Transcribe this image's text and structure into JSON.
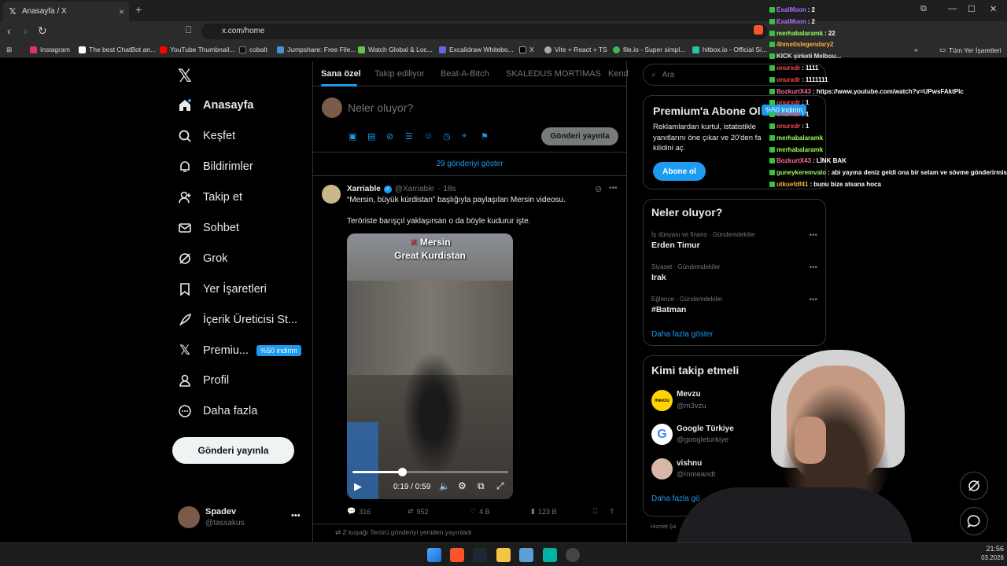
{
  "browser": {
    "tab_title": "Anasayfa / X",
    "url": "x.com/home",
    "bookmarks": [
      "Instagram",
      "The best ChatBot an...",
      "YouTube Thumbnail...",
      "cobalt",
      "Jumpshare: Free File...",
      "Watch Global & Loc...",
      "Excalidraw Whitebo...",
      "X",
      "Vite + React + TS",
      "file.io - Super simpl...",
      "hitbox.io - Official Si..."
    ],
    "bookmarks_all": "Tüm Yer İşaretleri"
  },
  "nav": {
    "items": [
      {
        "label": "Anasayfa",
        "icon": "home-icon"
      },
      {
        "label": "Keşfet",
        "icon": "search-icon"
      },
      {
        "label": "Bildirimler",
        "icon": "bell-icon"
      },
      {
        "label": "Takip et",
        "icon": "follow-icon"
      },
      {
        "label": "Sohbet",
        "icon": "mail-icon"
      },
      {
        "label": "Grok",
        "icon": "grok-icon"
      },
      {
        "label": "Yer İşaretleri",
        "icon": "bookmark-icon"
      },
      {
        "label": "İçerik Üreticisi St...",
        "icon": "rocket-icon"
      },
      {
        "label": "Premiu...",
        "icon": "x-icon"
      },
      {
        "label": "Profil",
        "icon": "profile-icon"
      },
      {
        "label": "Daha fazla",
        "icon": "more-icon"
      }
    ],
    "premium_badge": "%50 indirim",
    "post_button": "Gönderi yayınla",
    "user": {
      "name": "Spadev",
      "handle": "@tassakus"
    }
  },
  "feed": {
    "tabs": [
      "Sana özel",
      "Takip ediliyor",
      "Beat-A-Bitch",
      "SKALEDUS MORTIMAS",
      "Kend"
    ],
    "compose_placeholder": "Neler oluyor?",
    "compose_button": "Gönderi yayınla",
    "show_posts": "29 gönderiyi göster",
    "post": {
      "author": "Xarriable",
      "handle": "@Xarriable",
      "time": "18s",
      "text1": "“Mersin, büyük kürdistan” başlığıyla paylaşılan Mersin videosu.",
      "text2": "Teröriste barışçıl yaklaşırsan o da böyle kudurur işte.",
      "video_title1": "Mersin",
      "video_title2": "Great Kurdistan",
      "video_time": "0:19 / 0:59",
      "video_progress": 0.32,
      "replies": "316",
      "reposts": "952",
      "likes": "4 B",
      "views": "123 B"
    },
    "repost_note": "Z kuşağı Terörü gönderiyi yeniden yayınladı"
  },
  "right": {
    "search_placeholder": "Ara",
    "premium": {
      "title": "Premium'a Abone Ol",
      "badge": "%50 indirim",
      "text": "Reklamlardan kurtul, istatistikle yanıtlarını öne çıkar ve 20'den fa kilidini aç.",
      "button": "Abone ol"
    },
    "trends_title": "Neler oluyor?",
    "trends": [
      {
        "meta": "İş dünyası ve finans · Gündemdekiler",
        "name": "Erden Timur"
      },
      {
        "meta": "Siyaset · Gündemdekiler",
        "name": "Irak"
      },
      {
        "meta": "Eğlence · Gündemdekiler",
        "name": "#Batman"
      }
    ],
    "show_more": "Daha fazla göster",
    "who_title": "Kimi takip etmeli",
    "who": [
      {
        "name": "Mevzu",
        "handle": "@m3vzu"
      },
      {
        "name": "Google Türkiye",
        "handle": "@googleturkiye"
      },
      {
        "name": "vishnu",
        "handle": "@mmeandt"
      }
    ],
    "who_more": "Daha fazla gö",
    "footer": "Hizmet Şa"
  },
  "chat": [
    {
      "user": "ExalMoon",
      "msg": "2",
      "color": "#b36bff"
    },
    {
      "user": "ExalMoon",
      "msg": "2",
      "color": "#b36bff"
    },
    {
      "user": "merhabalaramk",
      "msg": "22",
      "color": "#9cff5a"
    },
    {
      "user": "4hmetislegendary2",
      "msg": "",
      "color": "#ffb13b"
    },
    {
      "user": "KICK şirketi Melbou...",
      "msg": "",
      "color": "#dddddd"
    },
    {
      "user": "onurxdr",
      "msg": "1111",
      "color": "#ff4d4d"
    },
    {
      "user": "onurxdr",
      "msg": "1111111",
      "color": "#ff4d4d"
    },
    {
      "user": "BozkurtX43",
      "msg": "https://www.youtube.com/watch?v=UPwsFAktPIc",
      "color": "#ff6b9a"
    },
    {
      "user": "onurxdr",
      "msg": "1",
      "color": "#ff4d4d"
    },
    {
      "user": "onurxdr",
      "msg": "1",
      "color": "#ff4d4d"
    },
    {
      "user": "onurxdr",
      "msg": "1",
      "color": "#ff4d4d"
    },
    {
      "user": "merhabalaramk",
      "msg": "",
      "color": "#9cff5a"
    },
    {
      "user": "merhabalaramk",
      "msg": "",
      "color": "#9cff5a"
    },
    {
      "user": "BozkurtX43",
      "msg": "LİNK BAK",
      "color": "#ff6b9a"
    },
    {
      "user": "guneykeremvalo",
      "msg": "abi yayına deniz geldi ona bir selam ve sövme gönderirmisin",
      "color": "#9cff5a"
    },
    {
      "user": "utkuefdf41",
      "msg": "bunu bize atsana hoca",
      "color": "#ffb13b"
    }
  ],
  "clock": {
    "time": "21:56",
    "date": "03.2026"
  }
}
